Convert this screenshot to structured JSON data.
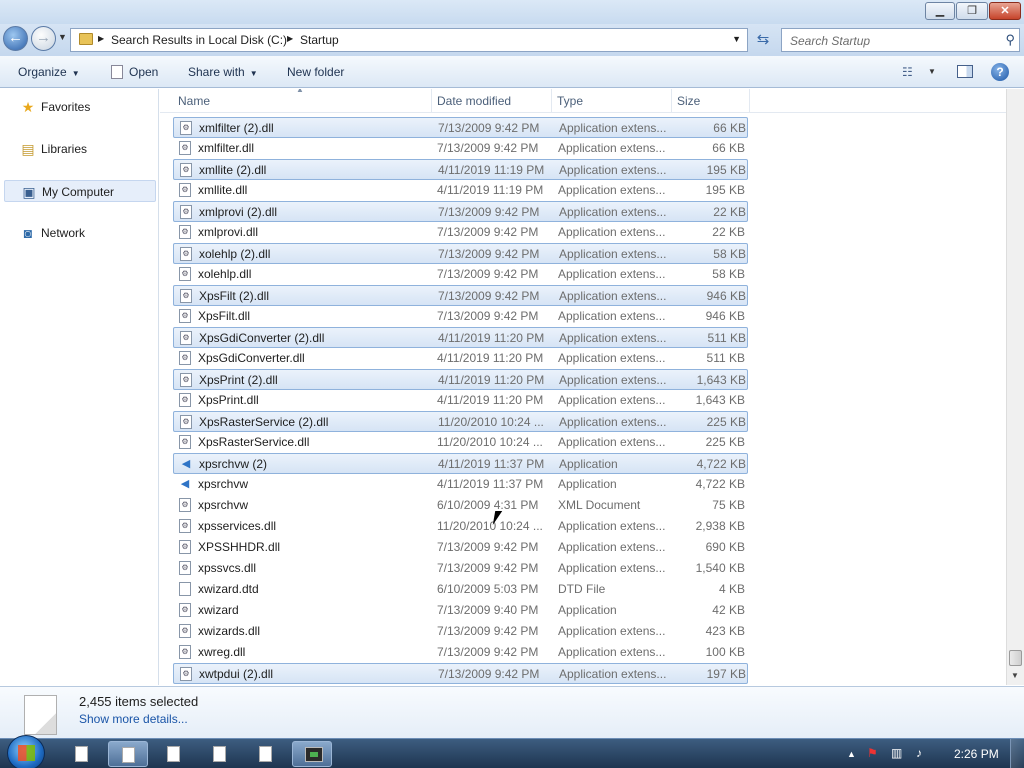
{
  "window": {
    "min_label": "▁",
    "max_label": "❐",
    "close_label": "✕"
  },
  "address": {
    "crumbs": [
      "Search Results in Local Disk (C:)",
      "Startup"
    ]
  },
  "search": {
    "placeholder": "Search Startup"
  },
  "toolbar": {
    "organize": "Organize",
    "open": "Open",
    "share_with": "Share with",
    "new_folder": "New folder"
  },
  "sidebar": {
    "items": [
      {
        "label": "Favorites",
        "icon": "star-icon"
      },
      {
        "label": "Libraries",
        "icon": "libraries-icon"
      },
      {
        "label": "My Computer",
        "icon": "computer-icon"
      },
      {
        "label": "Network",
        "icon": "network-icon"
      }
    ]
  },
  "columns": {
    "name": "Name",
    "date": "Date modified",
    "type": "Type",
    "size": "Size"
  },
  "files": [
    {
      "name": "xmlfilter (2).dll",
      "date": "7/13/2009 9:42 PM",
      "type": "Application extens...",
      "size": "66 KB",
      "selected": true,
      "icon": "dll"
    },
    {
      "name": "xmlfilter.dll",
      "date": "7/13/2009 9:42 PM",
      "type": "Application extens...",
      "size": "66 KB",
      "selected": false,
      "icon": "dll"
    },
    {
      "name": "xmllite (2).dll",
      "date": "4/11/2019 11:19 PM",
      "type": "Application extens...",
      "size": "195 KB",
      "selected": true,
      "icon": "dll"
    },
    {
      "name": "xmllite.dll",
      "date": "4/11/2019 11:19 PM",
      "type": "Application extens...",
      "size": "195 KB",
      "selected": false,
      "icon": "dll"
    },
    {
      "name": "xmlprovi (2).dll",
      "date": "7/13/2009 9:42 PM",
      "type": "Application extens...",
      "size": "22 KB",
      "selected": true,
      "icon": "dll"
    },
    {
      "name": "xmlprovi.dll",
      "date": "7/13/2009 9:42 PM",
      "type": "Application extens...",
      "size": "22 KB",
      "selected": false,
      "icon": "dll"
    },
    {
      "name": "xolehlp (2).dll",
      "date": "7/13/2009 9:42 PM",
      "type": "Application extens...",
      "size": "58 KB",
      "selected": true,
      "icon": "dll"
    },
    {
      "name": "xolehlp.dll",
      "date": "7/13/2009 9:42 PM",
      "type": "Application extens...",
      "size": "58 KB",
      "selected": false,
      "icon": "dll"
    },
    {
      "name": "XpsFilt (2).dll",
      "date": "7/13/2009 9:42 PM",
      "type": "Application extens...",
      "size": "946 KB",
      "selected": true,
      "icon": "dll"
    },
    {
      "name": "XpsFilt.dll",
      "date": "7/13/2009 9:42 PM",
      "type": "Application extens...",
      "size": "946 KB",
      "selected": false,
      "icon": "dll"
    },
    {
      "name": "XpsGdiConverter (2).dll",
      "date": "4/11/2019 11:20 PM",
      "type": "Application extens...",
      "size": "511 KB",
      "selected": true,
      "icon": "dll"
    },
    {
      "name": "XpsGdiConverter.dll",
      "date": "4/11/2019 11:20 PM",
      "type": "Application extens...",
      "size": "511 KB",
      "selected": false,
      "icon": "dll"
    },
    {
      "name": "XpsPrint (2).dll",
      "date": "4/11/2019 11:20 PM",
      "type": "Application extens...",
      "size": "1,643 KB",
      "selected": true,
      "icon": "dll"
    },
    {
      "name": "XpsPrint.dll",
      "date": "4/11/2019 11:20 PM",
      "type": "Application extens...",
      "size": "1,643 KB",
      "selected": false,
      "icon": "dll"
    },
    {
      "name": "XpsRasterService (2).dll",
      "date": "11/20/2010 10:24 ...",
      "type": "Application extens...",
      "size": "225 KB",
      "selected": true,
      "icon": "dll"
    },
    {
      "name": "XpsRasterService.dll",
      "date": "11/20/2010 10:24 ...",
      "type": "Application extens...",
      "size": "225 KB",
      "selected": false,
      "icon": "dll"
    },
    {
      "name": "xpsrchvw (2)",
      "date": "4/11/2019 11:37 PM",
      "type": "Application",
      "size": "4,722 KB",
      "selected": true,
      "icon": "app"
    },
    {
      "name": "xpsrchvw",
      "date": "4/11/2019 11:37 PM",
      "type": "Application",
      "size": "4,722 KB",
      "selected": false,
      "icon": "app"
    },
    {
      "name": "xpsrchvw",
      "date": "6/10/2009 4:31 PM",
      "type": "XML Document",
      "size": "75 KB",
      "selected": false,
      "icon": "xml"
    },
    {
      "name": "xpsservices.dll",
      "date": "11/20/2010 10:24 ...",
      "type": "Application extens...",
      "size": "2,938 KB",
      "selected": false,
      "icon": "dll"
    },
    {
      "name": "XPSSHHDR.dll",
      "date": "7/13/2009 9:42 PM",
      "type": "Application extens...",
      "size": "690 KB",
      "selected": false,
      "icon": "dll"
    },
    {
      "name": "xpssvcs.dll",
      "date": "7/13/2009 9:42 PM",
      "type": "Application extens...",
      "size": "1,540 KB",
      "selected": false,
      "icon": "dll"
    },
    {
      "name": "xwizard.dtd",
      "date": "6/10/2009 5:03 PM",
      "type": "DTD File",
      "size": "4 KB",
      "selected": false,
      "icon": "file"
    },
    {
      "name": "xwizard",
      "date": "7/13/2009 9:40 PM",
      "type": "Application",
      "size": "42 KB",
      "selected": false,
      "icon": "wizard"
    },
    {
      "name": "xwizards.dll",
      "date": "7/13/2009 9:42 PM",
      "type": "Application extens...",
      "size": "423 KB",
      "selected": false,
      "icon": "dll"
    },
    {
      "name": "xwreg.dll",
      "date": "7/13/2009 9:42 PM",
      "type": "Application extens...",
      "size": "100 KB",
      "selected": false,
      "icon": "dll"
    },
    {
      "name": "xwtpdui (2).dll",
      "date": "7/13/2009 9:42 PM",
      "type": "Application extens...",
      "size": "197 KB",
      "selected": true,
      "icon": "dll"
    }
  ],
  "details": {
    "count": "2,455 items selected",
    "more": "Show more details..."
  },
  "taskbar": {
    "clock": "2:26 PM"
  }
}
